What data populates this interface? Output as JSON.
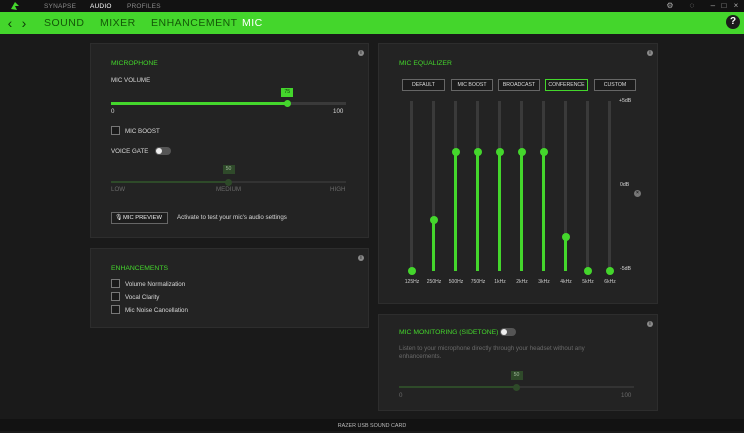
{
  "titlebar": {
    "tabs": [
      {
        "label": "SYNAPSE",
        "active": false
      },
      {
        "label": "AUDIO",
        "active": true
      },
      {
        "label": "PROFILES",
        "active": false
      }
    ]
  },
  "subnav": {
    "tabs": [
      {
        "label": "SOUND",
        "active": false
      },
      {
        "label": "MIXER",
        "active": false
      },
      {
        "label": "ENHANCEMENT",
        "active": false
      },
      {
        "label": "MIC",
        "active": true
      }
    ],
    "help_label": "?"
  },
  "microphone": {
    "title": "MICROPHONE",
    "mic_volume_label": "MIC VOLUME",
    "mic_volume_value": "75",
    "mic_volume_fraction": 0.75,
    "min_label": "0",
    "max_label": "100",
    "mic_boost_label": "MIC BOOST",
    "mic_boost_checked": false,
    "voice_gate_label": "VOICE GATE",
    "voice_gate_on": false,
    "gate_value": "50",
    "gate_fraction": 0.5,
    "gate_low": "LOW",
    "gate_medium": "MEDIUM",
    "gate_high": "HIGH",
    "mic_preview_label": "MIC PREVIEW",
    "mic_preview_hint": "Activate to test your mic's audio settings"
  },
  "enhancements": {
    "title": "ENHANCEMENTS",
    "items": [
      {
        "label": "Volume Normalization",
        "checked": false
      },
      {
        "label": "Vocal Clarity",
        "checked": false
      },
      {
        "label": "Mic Noise Cancellation",
        "checked": false
      }
    ]
  },
  "mic_equalizer": {
    "title": "MIC EQUALIZER",
    "presets": [
      {
        "label": "DEFAULT",
        "active": false
      },
      {
        "label": "MIC BOOST",
        "active": false
      },
      {
        "label": "BROADCAST",
        "active": false
      },
      {
        "label": "CONFERENCE",
        "active": true
      },
      {
        "label": "CUSTOM",
        "active": false
      }
    ],
    "db_top": "+5dB",
    "db_mid": "0dB",
    "db_bottom": "-5dB",
    "bands": [
      {
        "label": "125Hz",
        "level": 0.0
      },
      {
        "label": "250Hz",
        "level": 0.3
      },
      {
        "label": "500Hz",
        "level": 0.7
      },
      {
        "label": "750Hz",
        "level": 0.7
      },
      {
        "label": "1kHz",
        "level": 0.7
      },
      {
        "label": "2kHz",
        "level": 0.7
      },
      {
        "label": "3kHz",
        "level": 0.7
      },
      {
        "label": "4kHz",
        "level": 0.2
      },
      {
        "label": "5kHz",
        "level": 0.0
      },
      {
        "label": "6kHz",
        "level": 0.0
      }
    ]
  },
  "mic_monitoring": {
    "title": "MIC MONITORING (SIDETONE)",
    "enabled": false,
    "description": "Listen to your microphone directly through your headset without any enhancements.",
    "value": "50",
    "fraction": 0.5,
    "min_label": "0",
    "max_label": "100"
  },
  "footer": {
    "device": "RAZER USB SOUND CARD"
  }
}
